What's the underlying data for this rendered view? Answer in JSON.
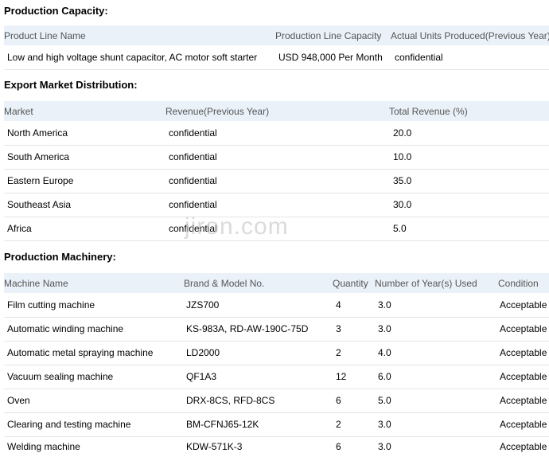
{
  "production_capacity": {
    "title": "Production Capacity:",
    "headers": [
      "Product Line Name",
      "Production Line Capacity",
      "Actual Units Produced(Previous Year)"
    ],
    "rows": [
      [
        "Low and high voltage shunt capacitor, AC motor soft starter",
        "USD 948,000 Per Month",
        "confidential"
      ]
    ]
  },
  "export_market": {
    "title": "Export Market Distribution:",
    "headers": [
      "Market",
      "Revenue(Previous Year)",
      "Total Revenue (%)"
    ],
    "rows": [
      [
        "North America",
        "confidential",
        "20.0"
      ],
      [
        "South America",
        "confidential",
        "10.0"
      ],
      [
        "Eastern Europe",
        "confidential",
        "35.0"
      ],
      [
        "Southeast Asia",
        "confidential",
        "30.0"
      ],
      [
        "Africa",
        "confidential",
        "5.0"
      ]
    ]
  },
  "machinery": {
    "title": "Production Machinery:",
    "headers": [
      "Machine Name",
      "Brand & Model No.",
      "Quantity",
      "Number of Year(s) Used",
      "Condition"
    ],
    "rows": [
      [
        "Film cutting machine",
        "JZS700",
        "4",
        "3.0",
        "Acceptable"
      ],
      [
        "Automatic winding machine",
        "KS-983A, RD-AW-190C-75D",
        "3",
        "3.0",
        "Acceptable"
      ],
      [
        "Automatic metal spraying machine",
        "LD2000",
        "2",
        "4.0",
        "Acceptable"
      ],
      [
        "Vacuum sealing machine",
        "QF1A3",
        "12",
        "6.0",
        "Acceptable"
      ],
      [
        "Oven",
        "DRX-8CS, RFD-8CS",
        "6",
        "5.0",
        "Acceptable"
      ],
      [
        "Clearing and testing machine",
        "BM-CFNJ65-12K",
        "2",
        "3.0",
        "Acceptable"
      ],
      [
        "Welding machine",
        "KDW-571K-3",
        "6",
        "3.0",
        "Acceptable"
      ]
    ]
  },
  "watermark": "jiron.com"
}
